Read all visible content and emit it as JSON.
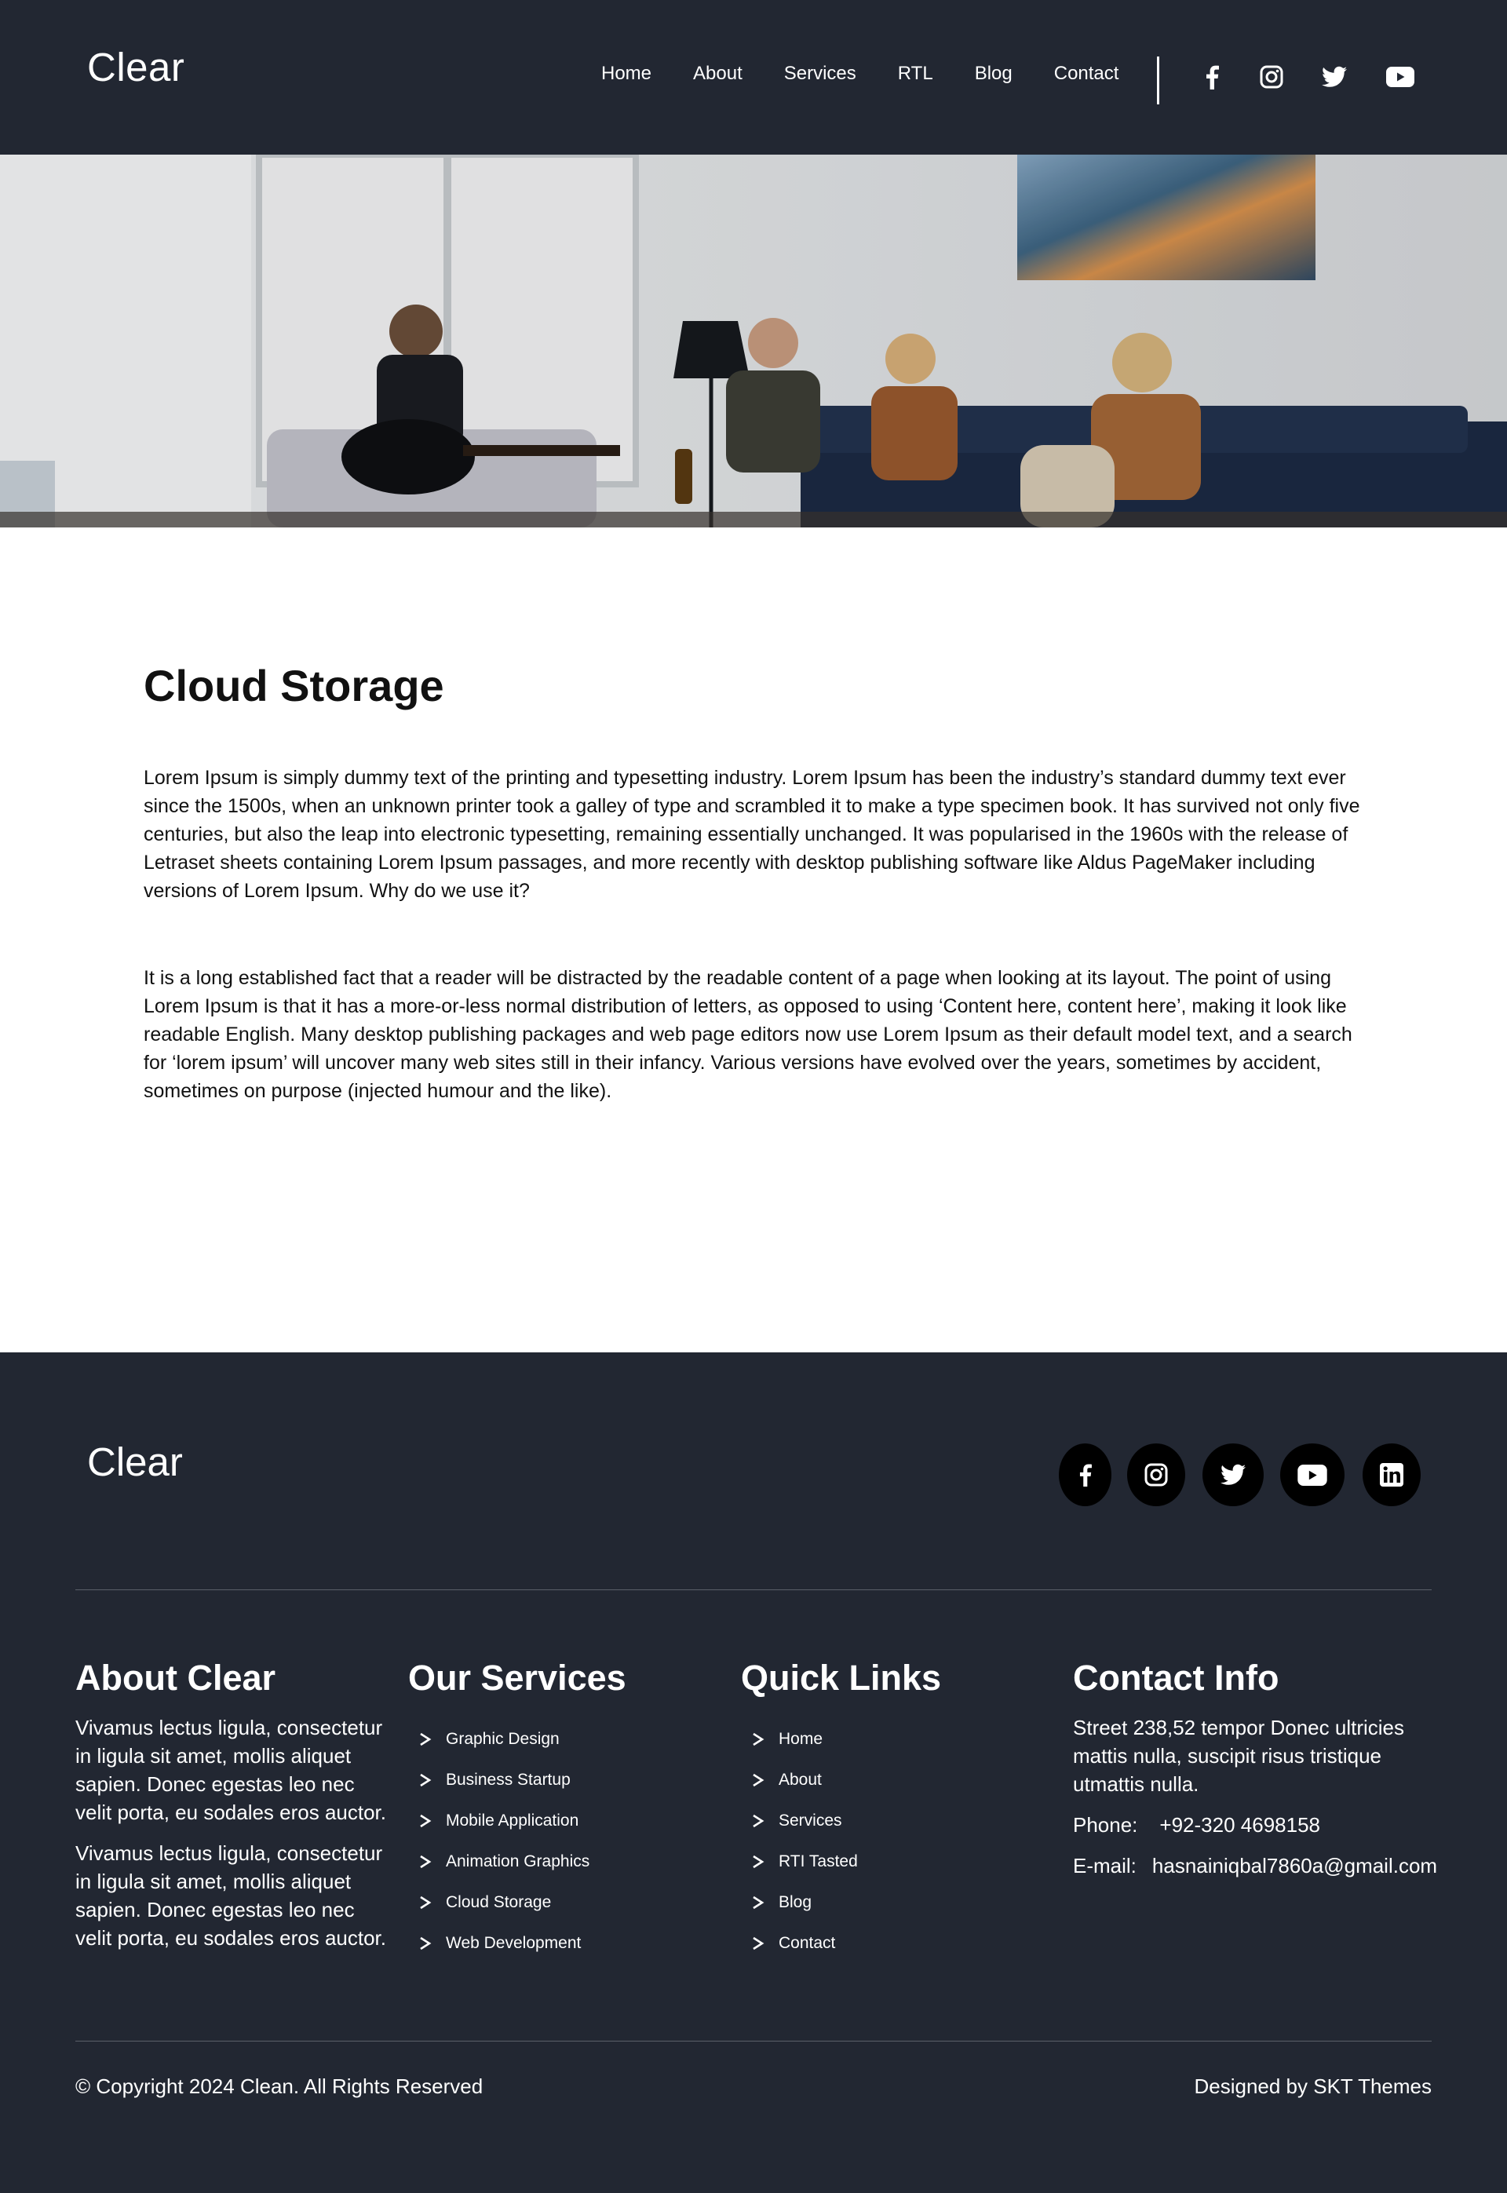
{
  "header": {
    "logo": "Clear",
    "nav": [
      "Home",
      "About",
      "Services",
      "RTL",
      "Blog",
      "Contact"
    ],
    "social_icons": [
      "facebook-icon",
      "instagram-icon",
      "twitter-icon",
      "youtube-icon"
    ]
  },
  "hero": {
    "image": "photo of four young people relaxing in a living room, one playing an acoustic guitar"
  },
  "main": {
    "title": "Cloud Storage",
    "paragraphs": [
      "Lorem Ipsum is simply dummy text of the printing and typesetting industry. Lorem Ipsum has been the industry’s standard dummy text ever since the 1500s, when an unknown printer took a galley of type and scrambled it to make a type specimen book. It has survived not only five centuries, but also the leap into electronic typesetting, remaining essentially unchanged. It was popularised in the 1960s with the release of Letraset sheets containing Lorem Ipsum passages, and more recently with desktop publishing software like Aldus PageMaker including versions of Lorem Ipsum. Why do we use it?",
      "It is a long established fact that a reader will be distracted by the readable content of a page when looking at its layout. The point of using Lorem Ipsum is that it has a more-or-less normal distribution of letters, as opposed to using ‘Content here, content here’, making it look like readable English. Many desktop publishing packages and web page editors now use Lorem Ipsum as their default model text, and a search for ‘lorem ipsum’ will uncover many web sites still in their infancy. Various versions have evolved over the years, sometimes by accident, sometimes on purpose (injected humour and the like)."
    ]
  },
  "footer": {
    "logo": "Clear",
    "social_icons": [
      "facebook-icon",
      "instagram-icon",
      "twitter-icon",
      "youtube-icon",
      "linkedin-icon"
    ],
    "about": {
      "title": "About Clear",
      "paragraphs": [
        "Vivamus lectus ligula, consectetur in ligula sit amet, mollis aliquet sapien. Donec egestas leo nec velit porta, eu sodales eros auctor.",
        "Vivamus lectus ligula, consectetur in ligula sit amet, mollis aliquet sapien. Donec egestas leo nec velit porta, eu sodales eros auctor."
      ]
    },
    "services": {
      "title": "Our Services",
      "items": [
        "Graphic Design",
        "Business Startup",
        "Mobile Application",
        "Animation Graphics",
        "Cloud Storage",
        "Web Development"
      ]
    },
    "links": {
      "title": "Quick Links",
      "items": [
        "Home",
        "About",
        "Services",
        "RTI Tasted",
        "Blog",
        "Contact"
      ]
    },
    "contact": {
      "title": "Contact Info",
      "address": "Street 238,52 tempor Donec ultricies mattis nulla, suscipit risus tristique utmattis nulla.",
      "phone_label": "Phone:",
      "phone": "+92-320 4698158",
      "email_label": "E-mail:",
      "email": "hasnainiqbal7860a@gmail.com"
    },
    "copyright": "© Copyright 2024 Clean. All Rights Reserved",
    "designed_by": "Designed by SKT Themes"
  }
}
